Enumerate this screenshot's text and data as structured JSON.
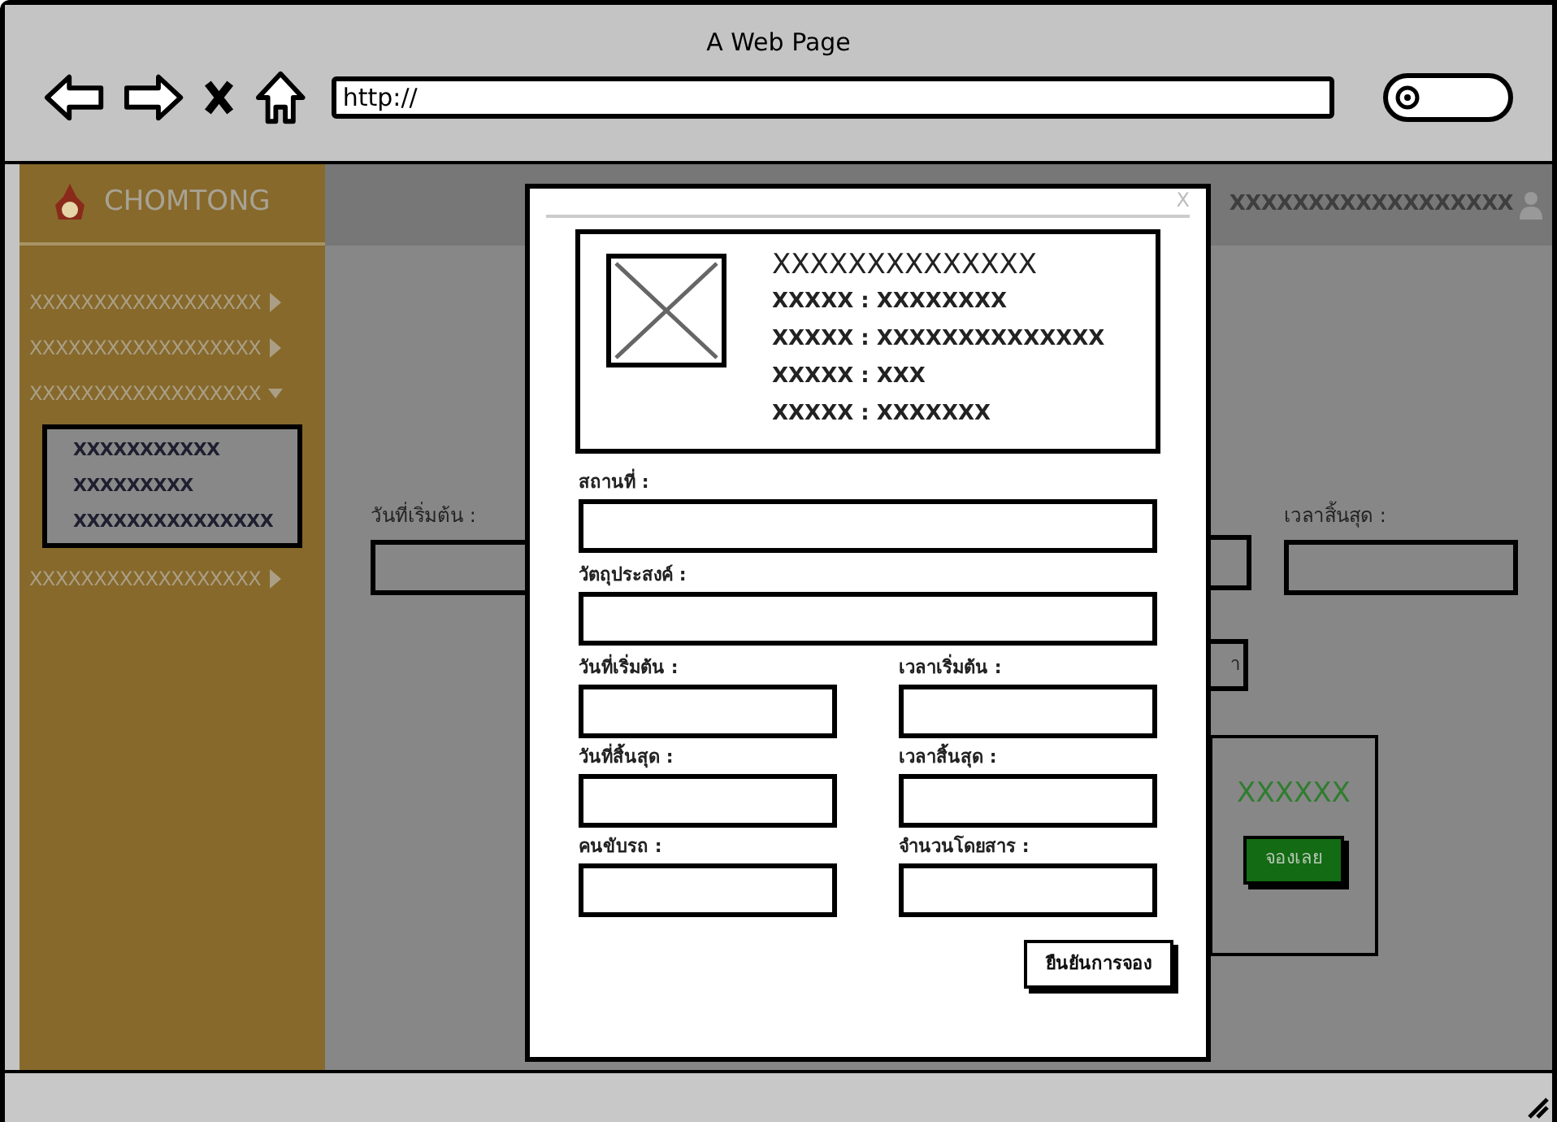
{
  "browser": {
    "title": "A Web Page",
    "url": "http://"
  },
  "sidebar": {
    "brand": "CHOMTONG",
    "items": [
      {
        "label": "XXXXXXXXXXXXXXXXXX",
        "expanded": false
      },
      {
        "label": "XXXXXXXXXXXXXXXXXX",
        "expanded": false
      },
      {
        "label": "XXXXXXXXXXXXXXXXXX",
        "expanded": true,
        "children": [
          {
            "label": "XXXXXXXXXXX"
          },
          {
            "label": "XXXXXXXXX"
          },
          {
            "label": "XXXXXXXXXXXXXXX"
          }
        ]
      },
      {
        "label": "XXXXXXXXXXXXXXXXXX",
        "expanded": false
      }
    ]
  },
  "header": {
    "user": "XXXXXXXXXXXXXXXXXX"
  },
  "background": {
    "start_date_label": "วันที่เริ่มต้น :",
    "end_time_label": "เวลาสิ้นสุด :",
    "button_fragment": "า",
    "card_title": "XXXXXX",
    "book_button": "จองเลย"
  },
  "dialog": {
    "close": "X",
    "info": {
      "title": "XXXXXXXXXXXXXX",
      "lines": [
        "XXXXX : XXXXXXXX",
        "XXXXX : XXXXXXXXXXXXXX",
        "XXXXX : XXX",
        "XXXXX : XXXXXXX"
      ]
    },
    "fields": [
      {
        "label": "สถานที่ :",
        "kind": "wide"
      },
      {
        "label": "วัตถุประสงค์ :",
        "kind": "wide"
      },
      {
        "label": "วันที่เริ่มต้น :",
        "kind": "narrow"
      },
      {
        "label": "เวลาเริ่มต้น :",
        "kind": "narrow"
      },
      {
        "label": "วันที่สิ้นสุด :",
        "kind": "narrow"
      },
      {
        "label": "เวลาสิ้นสุด :",
        "kind": "narrow"
      },
      {
        "label": "คนขับรถ :",
        "kind": "narrow"
      },
      {
        "label": "จำนวนโดยสาร :",
        "kind": "narrow"
      }
    ],
    "confirm": "ยืนยันการจอง"
  }
}
